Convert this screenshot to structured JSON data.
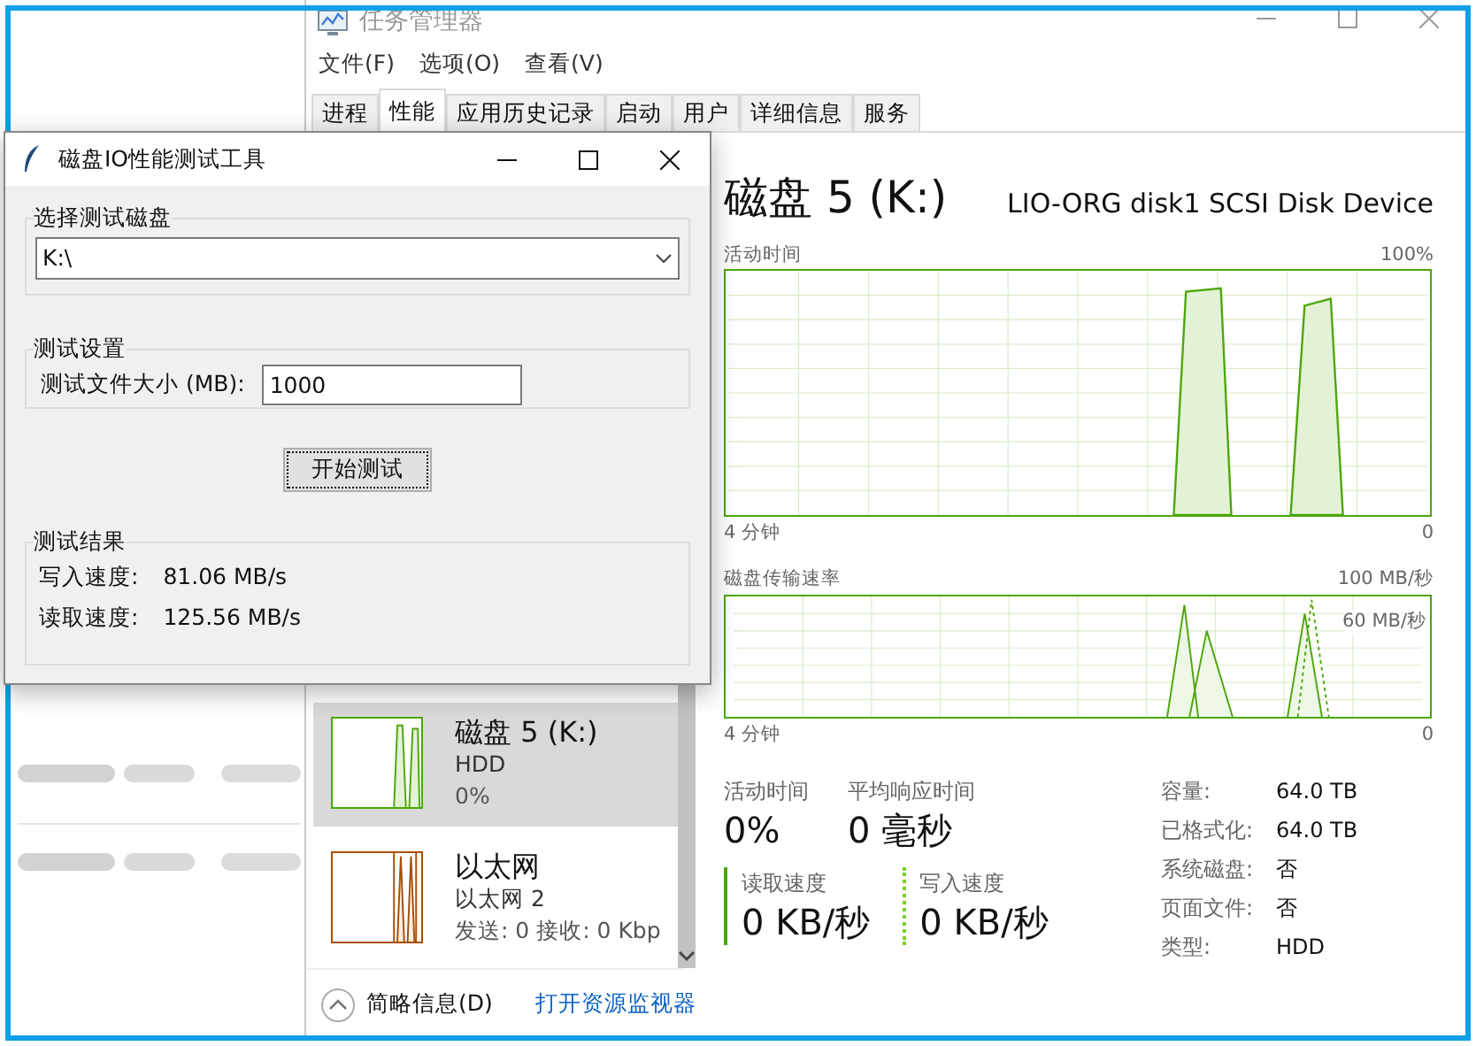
{
  "task_manager": {
    "title": "任务管理器",
    "menu": [
      "文件(F)",
      "选项(O)",
      "查看(V)"
    ],
    "tabs": [
      {
        "label": "进程",
        "selected": false
      },
      {
        "label": "性能",
        "selected": true
      },
      {
        "label": "应用历史记录",
        "selected": false
      },
      {
        "label": "启动",
        "selected": false
      },
      {
        "label": "用户",
        "selected": false
      },
      {
        "label": "详细信息",
        "selected": false
      },
      {
        "label": "服务",
        "selected": false
      }
    ],
    "sidebar": {
      "items": [
        {
          "kind": "disk",
          "title": "磁盘 5 (K:)",
          "subtitle": "HDD",
          "value": "0%",
          "selected": true,
          "color": "#4da60c"
        },
        {
          "kind": "network",
          "title": "以太网",
          "subtitle": "以太网 2",
          "value": "发送: 0 接收: 0 Kbp",
          "selected": false,
          "color": "#a74f01"
        }
      ]
    },
    "detail": {
      "title": "磁盘 5 (K:)",
      "model": "LIO-ORG disk1 SCSI Disk Device",
      "activity_graph": {
        "label": "活动时间",
        "max": "100%",
        "time": "4 分钟",
        "min": "0"
      },
      "transfer_graph": {
        "label": "磁盘传输速率",
        "max": "100 MB/秒",
        "mid": "60 MB/秒",
        "time": "4 分钟",
        "min": "0"
      },
      "stats": [
        {
          "label": "活动时间",
          "value": "0%"
        },
        {
          "label": "平均响应时间",
          "value": "0 毫秒"
        }
      ],
      "speeds": [
        {
          "kind": "read",
          "label": "读取速度",
          "value": "0 KB/秒"
        },
        {
          "kind": "write",
          "label": "写入速度",
          "value": "0 KB/秒"
        }
      ],
      "properties": [
        {
          "label": "容量:",
          "value": "64.0 TB"
        },
        {
          "label": "已格式化:",
          "value": "64.0 TB"
        },
        {
          "label": "系统磁盘:",
          "value": "否"
        },
        {
          "label": "页面文件:",
          "value": "否"
        },
        {
          "label": "类型:",
          "value": "HDD"
        }
      ]
    },
    "footer": {
      "summary": "简略信息(D)",
      "monitor_link": "打开资源监视器"
    }
  },
  "tool_window": {
    "title": "磁盘IO性能测试工具",
    "disk_group": {
      "title": "选择测试磁盘",
      "value": "K:\\"
    },
    "settings_group": {
      "title": "测试设置",
      "field_label": "测试文件大小 (MB):",
      "value": "1000"
    },
    "start_button": "开始测试",
    "results_group": {
      "title": "测试结果",
      "rows": [
        {
          "label": "写入速度:",
          "value": "81.06 MB/s"
        },
        {
          "label": "读取速度:",
          "value": "125.56 MB/s"
        }
      ]
    }
  }
}
